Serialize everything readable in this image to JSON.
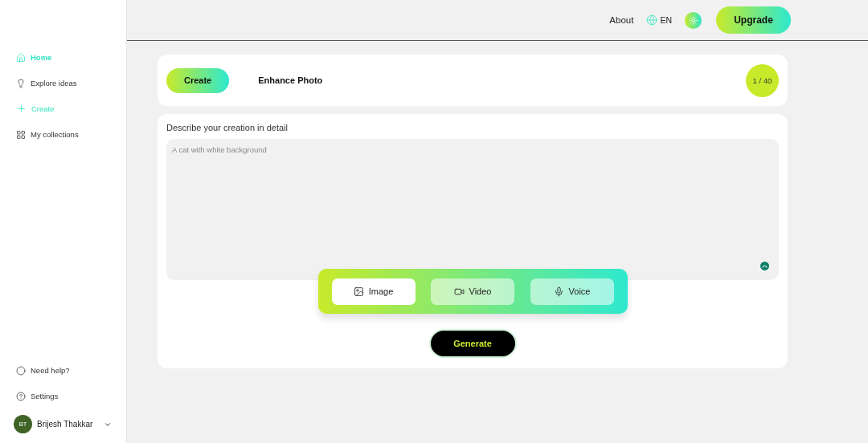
{
  "sidebar": {
    "items": [
      {
        "label": "Home",
        "kind": "nav",
        "selected": true
      },
      {
        "label": "Explore ideas",
        "kind": "nav",
        "selected": false
      },
      {
        "label": "Create",
        "kind": "action",
        "selected": false
      },
      {
        "label": "My collections",
        "kind": "nav",
        "selected": false
      }
    ],
    "footer_items": [
      {
        "label": "Need help?"
      },
      {
        "label": "Settings"
      }
    ],
    "user": {
      "initials": "BT",
      "name": "Brijesh Thakkar"
    }
  },
  "header": {
    "about": "About",
    "language": "EN",
    "upgrade": "Upgrade"
  },
  "tabs": [
    {
      "label": "Create",
      "selected": true
    },
    {
      "label": "Enhance Photo",
      "selected": false
    }
  ],
  "credits": "1 / 40",
  "prompt": {
    "label": "Describe your creation in detail",
    "placeholder": "A cat with white background"
  },
  "media_types": [
    {
      "label": "Image",
      "selected": true
    },
    {
      "label": "Video",
      "selected": false
    },
    {
      "label": "Voice",
      "selected": false
    }
  ],
  "generate": "Generate"
}
